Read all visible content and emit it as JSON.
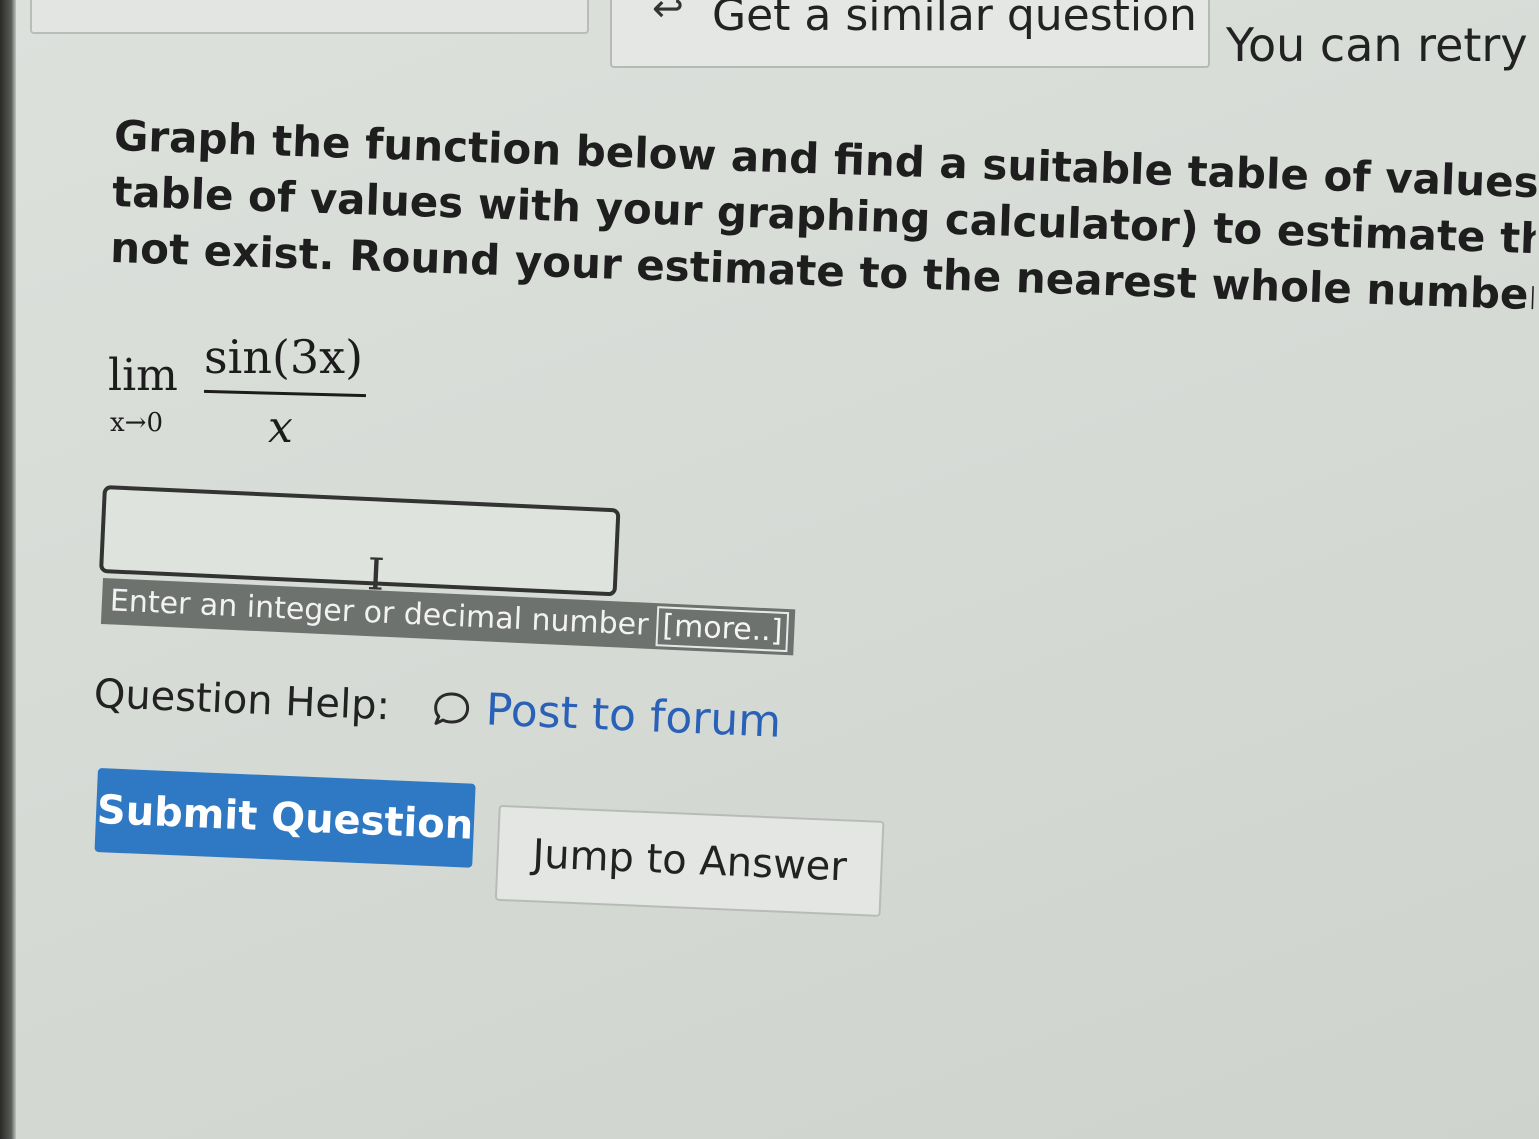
{
  "topbar": {
    "similar_icon": "↩",
    "similar_label": "Get a similar question",
    "retry_text": "You can retry"
  },
  "question": {
    "lines": [
      "Graph the function below and find a suitable table of values (you can",
      "table of values with your graphing calculator) to estimate the limit n",
      "not exist. Round your estimate to the nearest whole number."
    ]
  },
  "math": {
    "lim": "lim",
    "subscript": "x→0",
    "numerator": "sin(3x)",
    "denominator": "x"
  },
  "answer": {
    "value": "",
    "hint": "Enter an integer or decimal number",
    "more_label": "[more..]"
  },
  "help": {
    "label": "Question Help:",
    "forum_link": "Post to forum",
    "icon": "chat-bubble-icon"
  },
  "buttons": {
    "submit": "Submit Question",
    "jump": "Jump to Answer"
  },
  "colors": {
    "submit_bg": "#2f79c4",
    "link": "#2a61b8",
    "hint_bg": "#6e726e"
  }
}
